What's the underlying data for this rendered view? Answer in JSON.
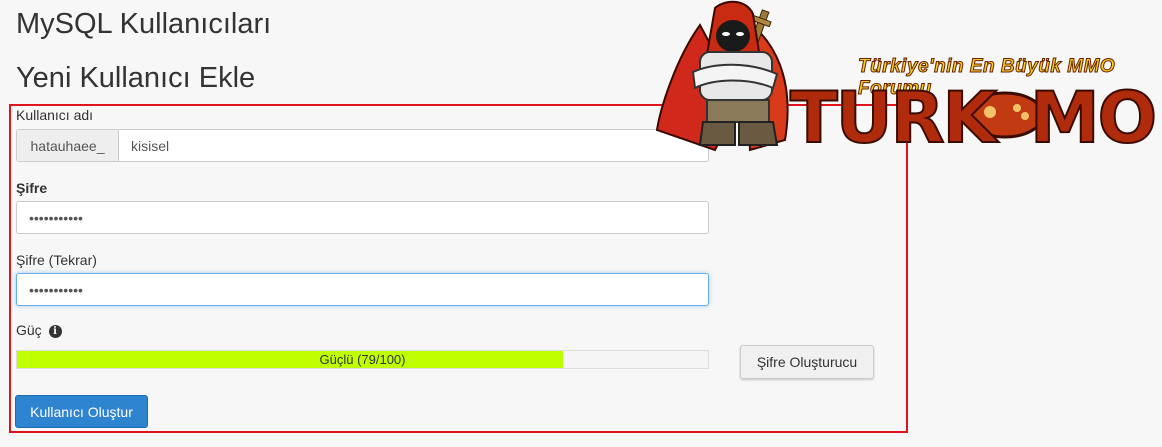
{
  "header": {
    "page_title": "MySQL Kullanıcıları",
    "section_title": "Yeni Kullanıcı Ekle"
  },
  "form": {
    "username_label": "Kullanıcı adı",
    "username_prefix": "hatauhaee_",
    "username_value": "kisisel",
    "password_label": "Şifre",
    "password_value": "•••••••••••",
    "password_again_label": "Şifre (Tekrar)",
    "password_again_value": "•••••••••••",
    "strength_label": "Güç",
    "strength_text": "Güçlü (79/100)",
    "strength_value": 79,
    "strength_max": 100,
    "generator_button": "Şifre Oluşturucu",
    "create_button": "Kullanıcı Oluştur"
  },
  "watermark": {
    "tagline": "Türkiye'nin En Büyük MMO Forumu",
    "logo_text_left": "TURK",
    "logo_text_right": "MO"
  },
  "colors": {
    "highlight_border": "#e0141e",
    "strength_fill": "#bfff00",
    "primary_button": "#2f84cf",
    "focus_border": "#66afe9"
  }
}
